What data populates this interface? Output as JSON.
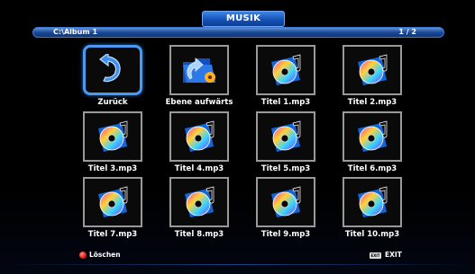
{
  "header": {
    "title": "MUSIK"
  },
  "path_bar": {
    "path": "C:\\Album 1",
    "page": "1 / 2"
  },
  "items": [
    {
      "label": "Zurück",
      "icon": "back-arrow-icon",
      "selected": true
    },
    {
      "label": "Ebene aufwärts",
      "icon": "folder-up-icon",
      "selected": false
    },
    {
      "label": "Titel 1.mp3",
      "icon": "music-cd-icon",
      "selected": false
    },
    {
      "label": "Titel 2.mp3",
      "icon": "music-cd-icon",
      "selected": false
    },
    {
      "label": "Titel 3.mp3",
      "icon": "music-cd-icon",
      "selected": false
    },
    {
      "label": "Titel 4.mp3",
      "icon": "music-cd-icon",
      "selected": false
    },
    {
      "label": "Titel 5.mp3",
      "icon": "music-cd-icon",
      "selected": false
    },
    {
      "label": "Titel 6.mp3",
      "icon": "music-cd-icon",
      "selected": false
    },
    {
      "label": "Titel 7.mp3",
      "icon": "music-cd-icon",
      "selected": false
    },
    {
      "label": "Titel 8.mp3",
      "icon": "music-cd-icon",
      "selected": false
    },
    {
      "label": "Titel 9.mp3",
      "icon": "music-cd-icon",
      "selected": false
    },
    {
      "label": "Titel 10.mp3",
      "icon": "music-cd-icon",
      "selected": false
    }
  ],
  "footer": {
    "delete_label": "Löschen",
    "exit_key": "EXIT",
    "exit_label": "EXIT"
  },
  "colors": {
    "accent": "#1652b8",
    "selection": "#4a9af0",
    "delete_button": "#e01a12"
  }
}
